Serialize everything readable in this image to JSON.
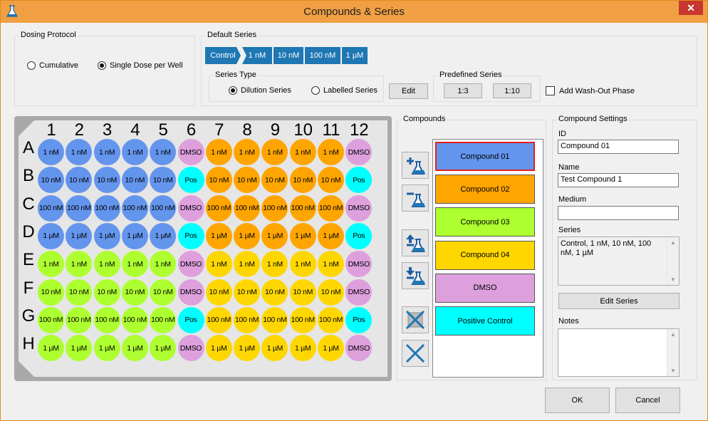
{
  "window": {
    "title": "Compounds & Series",
    "close_label": "✕",
    "accent": "#f0a043"
  },
  "dosing_protocol": {
    "label": "Dosing Protocol",
    "options": [
      {
        "label": "Cumulative",
        "selected": false
      },
      {
        "label": "Single Dose per Well",
        "selected": true
      }
    ]
  },
  "default_series": {
    "label": "Default Series",
    "chips": [
      "Control",
      "1 nM",
      "10 nM",
      "100 nM",
      "1 µM"
    ],
    "series_type": {
      "label": "Series Type",
      "options": [
        {
          "label": "Dilution Series",
          "selected": true
        },
        {
          "label": "Labelled Series",
          "selected": false
        }
      ]
    },
    "edit_label": "Edit",
    "predefined": {
      "label": "Predefined Series",
      "buttons": [
        "1:3",
        "1:10"
      ]
    },
    "washout_label": "Add Wash-Out Phase"
  },
  "plate": {
    "columns": [
      "1",
      "2",
      "3",
      "4",
      "5",
      "6",
      "7",
      "8",
      "9",
      "10",
      "11",
      "12"
    ],
    "rows": [
      {
        "label": "A",
        "wells": [
          [
            "1 nM",
            "blue"
          ],
          [
            "1 nM",
            "blue"
          ],
          [
            "1 nM",
            "blue"
          ],
          [
            "1 nM",
            "blue"
          ],
          [
            "1 nM",
            "blue"
          ],
          [
            "DMSO",
            "pink"
          ],
          [
            "1 nM",
            "orange"
          ],
          [
            "1 nM",
            "orange"
          ],
          [
            "1 nM",
            "orange"
          ],
          [
            "1 nM",
            "orange"
          ],
          [
            "1 nM",
            "orange"
          ],
          [
            "DMSO",
            "pink"
          ]
        ]
      },
      {
        "label": "B",
        "wells": [
          [
            "10 nM",
            "blue"
          ],
          [
            "10 nM",
            "blue"
          ],
          [
            "10 nM",
            "blue"
          ],
          [
            "10 nM",
            "blue"
          ],
          [
            "10 nM",
            "blue"
          ],
          [
            "Pos",
            "cyan"
          ],
          [
            "10 nM",
            "orange"
          ],
          [
            "10 nM",
            "orange"
          ],
          [
            "10 nM",
            "orange"
          ],
          [
            "10 nM",
            "orange"
          ],
          [
            "10 nM",
            "orange"
          ],
          [
            "Pos",
            "cyan"
          ]
        ]
      },
      {
        "label": "C",
        "wells": [
          [
            "100 nM",
            "blue"
          ],
          [
            "100 nM",
            "blue"
          ],
          [
            "100 nM",
            "blue"
          ],
          [
            "100 nM",
            "blue"
          ],
          [
            "100 nM",
            "blue"
          ],
          [
            "DMSO",
            "pink"
          ],
          [
            "100 nM",
            "orange"
          ],
          [
            "100 nM",
            "orange"
          ],
          [
            "100 nM",
            "orange"
          ],
          [
            "100 nM",
            "orange"
          ],
          [
            "100 nM",
            "orange"
          ],
          [
            "DMSO",
            "pink"
          ]
        ]
      },
      {
        "label": "D",
        "wells": [
          [
            "1 µM",
            "blue"
          ],
          [
            "1 µM",
            "blue"
          ],
          [
            "1 µM",
            "blue"
          ],
          [
            "1 µM",
            "blue"
          ],
          [
            "1 µM",
            "blue"
          ],
          [
            "Pos",
            "cyan"
          ],
          [
            "1 µM",
            "orange"
          ],
          [
            "1 µM",
            "orange"
          ],
          [
            "1 µM",
            "orange"
          ],
          [
            "1 µM",
            "orange"
          ],
          [
            "1 µM",
            "orange"
          ],
          [
            "Pos",
            "cyan"
          ]
        ]
      },
      {
        "label": "E",
        "wells": [
          [
            "1 nM",
            "green"
          ],
          [
            "1 nM",
            "green"
          ],
          [
            "1 nM",
            "green"
          ],
          [
            "1 nM",
            "green"
          ],
          [
            "1 nM",
            "green"
          ],
          [
            "DMSO",
            "pink"
          ],
          [
            "1 nM",
            "yellow"
          ],
          [
            "1 nM",
            "yellow"
          ],
          [
            "1 nM",
            "yellow"
          ],
          [
            "1 nM",
            "yellow"
          ],
          [
            "1 nM",
            "yellow"
          ],
          [
            "DMSO",
            "pink"
          ]
        ]
      },
      {
        "label": "F",
        "wells": [
          [
            "10 nM",
            "green"
          ],
          [
            "10 nM",
            "green"
          ],
          [
            "10 nM",
            "green"
          ],
          [
            "10 nM",
            "green"
          ],
          [
            "10 nM",
            "green"
          ],
          [
            "DMSO",
            "pink"
          ],
          [
            "10 nM",
            "yellow"
          ],
          [
            "10 nM",
            "yellow"
          ],
          [
            "10 nM",
            "yellow"
          ],
          [
            "10 nM",
            "yellow"
          ],
          [
            "10 nM",
            "yellow"
          ],
          [
            "DMSO",
            "pink"
          ]
        ]
      },
      {
        "label": "G",
        "wells": [
          [
            "100 nM",
            "green"
          ],
          [
            "100 nM",
            "green"
          ],
          [
            "100 nM",
            "green"
          ],
          [
            "100 nM",
            "green"
          ],
          [
            "100 nM",
            "green"
          ],
          [
            "Pos",
            "cyan"
          ],
          [
            "100 nM",
            "yellow"
          ],
          [
            "100 nM",
            "yellow"
          ],
          [
            "100 nM",
            "yellow"
          ],
          [
            "100 nM",
            "yellow"
          ],
          [
            "100 nM",
            "yellow"
          ],
          [
            "Pos",
            "cyan"
          ]
        ]
      },
      {
        "label": "H",
        "wells": [
          [
            "1 µM",
            "green"
          ],
          [
            "1 µM",
            "green"
          ],
          [
            "1 µM",
            "green"
          ],
          [
            "1 µM",
            "green"
          ],
          [
            "1 µM",
            "green"
          ],
          [
            "DMSO",
            "pink"
          ],
          [
            "1 µM",
            "yellow"
          ],
          [
            "1 µM",
            "yellow"
          ],
          [
            "1 µM",
            "yellow"
          ],
          [
            "1 µM",
            "yellow"
          ],
          [
            "1 µM",
            "yellow"
          ],
          [
            "DMSO",
            "pink"
          ]
        ]
      }
    ]
  },
  "colors": {
    "blue": "#6495ed",
    "orange": "#ffa500",
    "green": "#adff2f",
    "yellow": "#ffd700",
    "pink": "#dda0dd",
    "cyan": "#00ffff",
    "selected_border": "#e0201e"
  },
  "compounds": {
    "label": "Compounds",
    "items": [
      {
        "name": "Compound 01",
        "color": "blue",
        "selected": true
      },
      {
        "name": "Compound 02",
        "color": "orange",
        "selected": false
      },
      {
        "name": "Compound 03",
        "color": "green",
        "selected": false
      },
      {
        "name": "Compound 04",
        "color": "yellow",
        "selected": false
      },
      {
        "name": "DMSO",
        "color": "pink",
        "selected": false
      },
      {
        "name": "Positive Control",
        "color": "cyan",
        "selected": false
      }
    ],
    "tools": [
      "add-compound-icon",
      "remove-compound-icon",
      "move-up-icon",
      "move-down-icon",
      "clear-wells-icon",
      "delete-icon"
    ]
  },
  "settings": {
    "label": "Compound Settings",
    "id_label": "ID",
    "id_value": "Compound 01",
    "name_label": "Name",
    "name_value": "Test Compound 1",
    "medium_label": "Medium",
    "medium_value": "",
    "series_label": "Series",
    "series_value": "Control, 1 nM, 10 nM, 100 nM, 1 µM",
    "edit_series_label": "Edit Series",
    "notes_label": "Notes",
    "notes_value": ""
  },
  "footer": {
    "ok_label": "OK",
    "cancel_label": "Cancel"
  }
}
